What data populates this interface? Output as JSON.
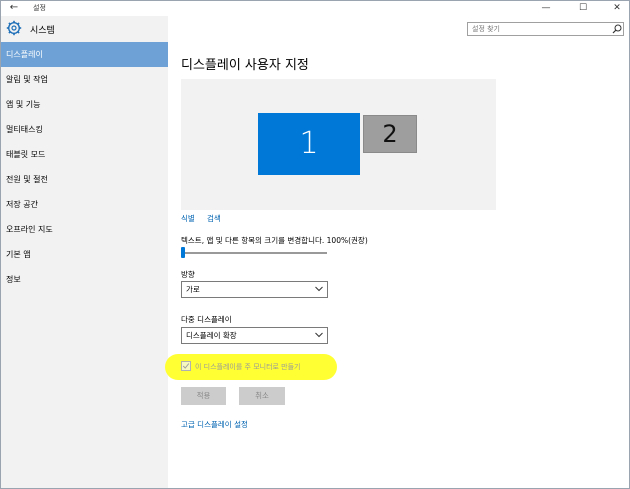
{
  "window": {
    "title": "설정",
    "back_icon": "back-arrow-icon",
    "minimize": "—",
    "maximize": "☐",
    "close": "✕"
  },
  "sidebar": {
    "header_icon": "gear-icon",
    "title": "시스템",
    "items": [
      {
        "label": "디스플레이",
        "active": true
      },
      {
        "label": "알림 및 작업",
        "active": false
      },
      {
        "label": "앱 및 기능",
        "active": false
      },
      {
        "label": "멀티태스킹",
        "active": false
      },
      {
        "label": "태블릿 모드",
        "active": false
      },
      {
        "label": "전원 및 절전",
        "active": false
      },
      {
        "label": "저장 공간",
        "active": false
      },
      {
        "label": "오프라인 지도",
        "active": false
      },
      {
        "label": "기본 앱",
        "active": false
      },
      {
        "label": "정보",
        "active": false
      }
    ]
  },
  "search": {
    "placeholder": "설정 찾기",
    "icon": "search-icon"
  },
  "main": {
    "title": "디스플레이 사용자 지정",
    "monitors": {
      "primary": "1",
      "secondary": "2"
    },
    "identify_link": "식별",
    "detect_link": "검색",
    "scale_label": "텍스트, 앱 및 다른 항목의 크기를 변경합니다. 100%(권장)",
    "scale_value_percent": 0,
    "orientation_label": "방향",
    "orientation_value": "가로",
    "multiple_label": "다중 디스플레이",
    "multiple_value": "디스플레이 확장",
    "main_display_checkbox": "이 디스플레이를 주 모니터로 만들기",
    "apply_button": "적용",
    "cancel_button": "취소",
    "advanced_link": "고급 디스플레이 설정"
  },
  "colors": {
    "accent": "#0078d7",
    "sidebar_active": "#6ea2d6",
    "highlight": "#ffff33"
  }
}
